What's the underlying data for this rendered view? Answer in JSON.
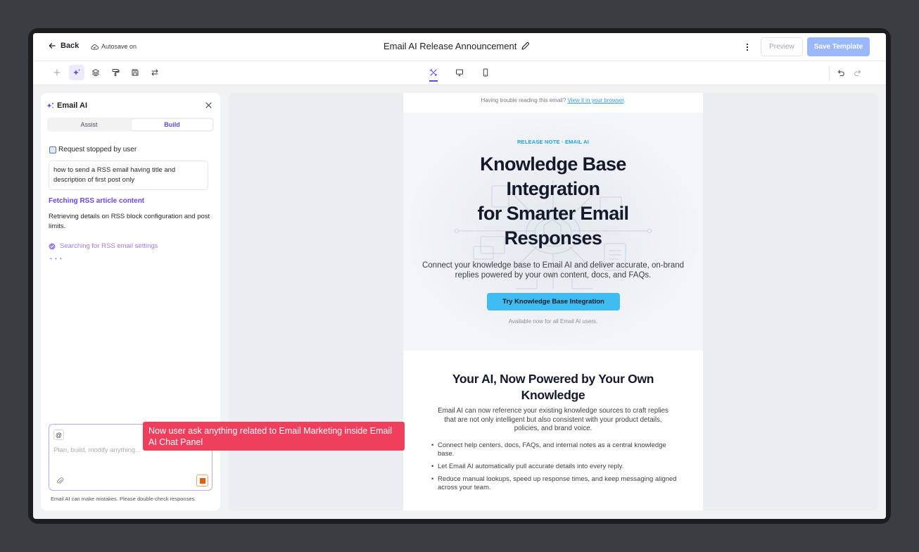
{
  "header": {
    "back_label": "Back",
    "autosave_label": "Autosave on",
    "title": "Email AI Release Announcement",
    "preview_label": "Preview",
    "save_label": "Save Template"
  },
  "toolbar": {
    "left_icons": [
      "plus-icon",
      "sparkles-icon",
      "layers-icon",
      "paint-roller-icon",
      "save-icon",
      "swap-icon"
    ],
    "center_icons": [
      "tools-icon",
      "desktop-icon",
      "mobile-icon"
    ],
    "right_icons": [
      "undo-icon",
      "redo-icon"
    ],
    "active_left": "sparkles-icon",
    "active_center": "tools-icon"
  },
  "panel": {
    "title": "Email AI",
    "tabs": [
      "Assist",
      "Build"
    ],
    "active_tab": "Build",
    "status": "Request stopped by user",
    "query": "how to send a RSS email having title and description of first post only",
    "step_title": "Fetching RSS article content",
    "step_detail": "Retrieving details on RSS block configuration and post limits.",
    "searching": "Searching for RSS email settings",
    "chat": {
      "placeholder": "Plan, build, modify anything...",
      "at_label": "@"
    },
    "disclaimer": "Email AI can make mistakes. Please double-check responses."
  },
  "tooltip": {
    "text": "Now user ask anything related to Email Marketing inside Email AI Chat Panel"
  },
  "email": {
    "trouble_text": "Having trouble reading this email?",
    "trouble_link": "View it in your browser",
    "trouble_end": ".",
    "eyebrow": "RELEASE NOTE · EMAIL AI",
    "headline_line1": "Knowledge Base",
    "headline_line2": "Integration",
    "headline_line3": "for Smarter Email",
    "headline_line4": "Responses",
    "hero_sub": "Connect your knowledge base to Email AI and deliver accurate, on-brand replies powered by your own content, docs, and FAQs.",
    "cta_label": "Try Knowledge Base Integration",
    "available": "Available now for all Email AI users.",
    "section_title": "Your AI, Now Powered by Your Own Knowledge",
    "section_body": "Email AI can now reference your existing knowledge sources to craft replies that are not only intelligent but also consistent with your product details, policies, and brand voice.",
    "bullets": [
      "Connect help centers, docs, FAQs, and internal notes as a central knowledge base.",
      "Let Email AI automatically pull accurate details into every reply.",
      "Reduce manual lookups, speed up response times, and keep messaging aligned across your team."
    ]
  },
  "colors": {
    "accent": "#5b49e8",
    "save_button": "#9bb8fb",
    "cta": "#3fbdf0",
    "tooltip": "#f03f5d"
  }
}
